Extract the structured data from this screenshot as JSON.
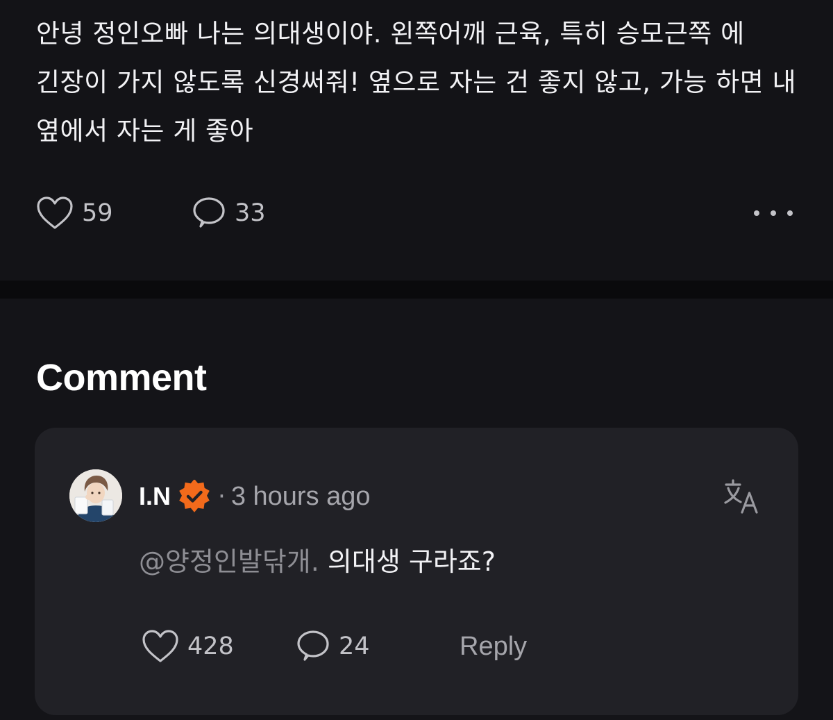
{
  "post": {
    "text": "안녕 정인오빠 나는 의대생이야. 왼쪽어깨 근육, 특히 승모근쪽 에 긴장이 가지 않도록 신경써줘! 옆으로 자는 건 좋지 않고, 가능 하면 내 옆에서 자는 게 좋아",
    "likes": "59",
    "comments": "33"
  },
  "comments_section": {
    "heading": "Comment",
    "comment": {
      "author": "I.N",
      "separator": "·",
      "time": "3 hours ago",
      "mention": "@양정인발닦개.",
      "text": " 의대생 구라죠?",
      "likes": "428",
      "replies": "24",
      "reply_label": "Reply"
    }
  },
  "icons": {
    "like": "heart-outline-icon",
    "comment": "speech-bubble-icon",
    "more": "more-horizontal-icon",
    "verified": "verified-badge-icon",
    "translate": "translate-icon"
  },
  "colors": {
    "background": "#131317",
    "card": "#212126",
    "verified_badge": "#f26a1b",
    "muted_text": "#a6a6ac"
  }
}
